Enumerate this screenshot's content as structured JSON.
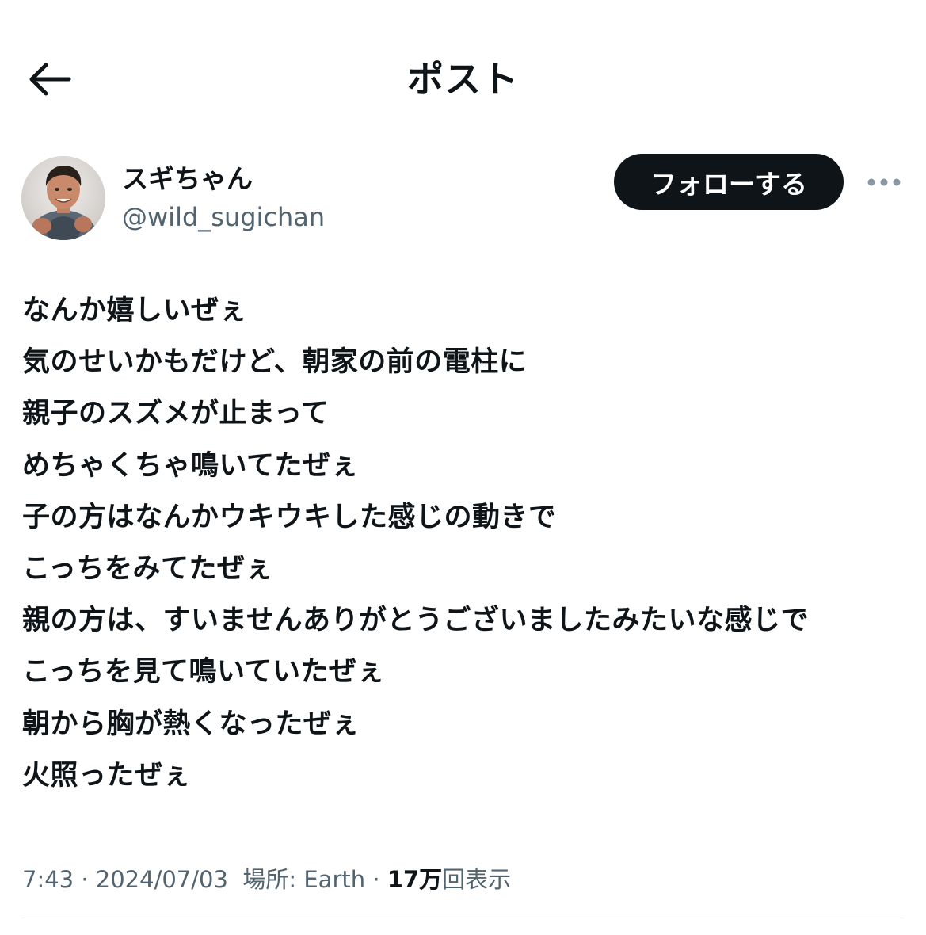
{
  "header": {
    "title": "ポスト",
    "back_icon": "arrow-left-icon"
  },
  "author": {
    "display_name": "スギちゃん",
    "handle": "@wild_sugichan",
    "avatar_icon": "user-avatar",
    "follow_label": "フォローする",
    "more_icon": "more-horizontal-icon"
  },
  "post": {
    "lines": [
      "なんか嬉しいぜぇ",
      "気のせいかもだけど、朝家の前の電柱に",
      "親子のスズメが止まって",
      "めちゃくちゃ鳴いてたぜぇ",
      "子の方はなんかウキウキした感じの動きで",
      "こっちをみてたぜぇ",
      "親の方は、すいませんありがとうございましたみたいな感じで",
      "こっちを見て鳴いていたぜぇ",
      "朝から胸が熱くなったぜぇ",
      "火照ったぜぇ"
    ]
  },
  "meta": {
    "time": "7:43",
    "separator": " · ",
    "date": "2024/07/03",
    "location_label": "場所: Earth",
    "views_count": "17万",
    "views_label": "回表示"
  },
  "colors": {
    "text_primary": "#0f1419",
    "text_secondary": "#536471",
    "follow_bg": "#0f1419",
    "follow_text": "#ffffff",
    "divider": "#e6e9eb"
  }
}
